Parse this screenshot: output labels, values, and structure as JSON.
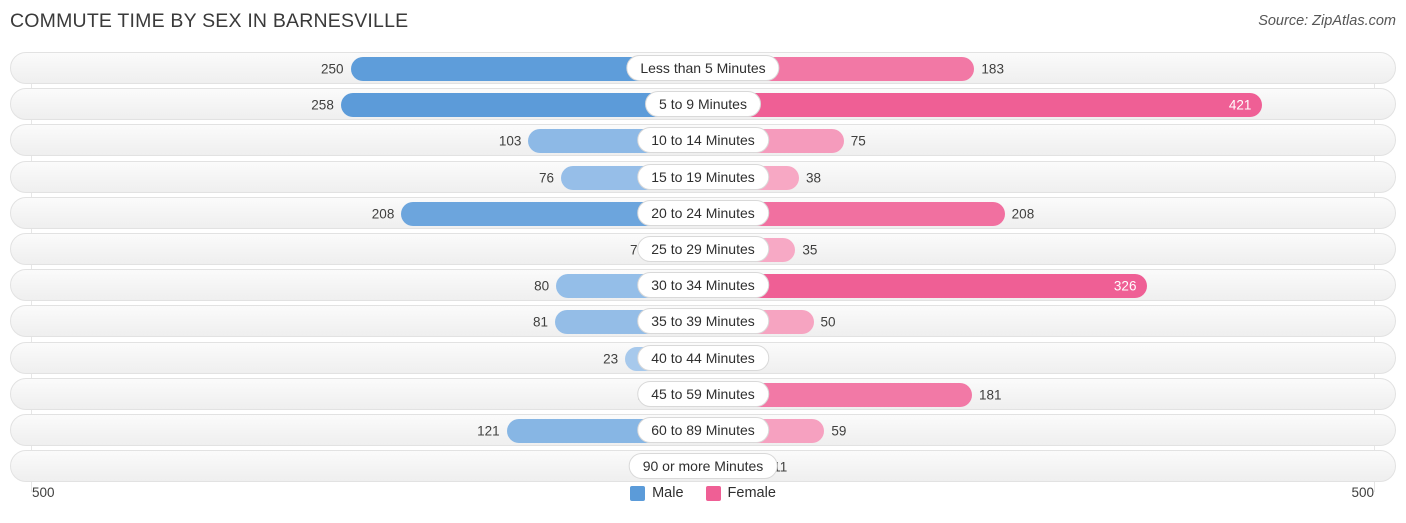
{
  "header": {
    "title": "COMMUTE TIME BY SEX IN BARNESVILLE",
    "source": "Source: ZipAtlas.com"
  },
  "axis": {
    "left_label": "500",
    "right_label": "500"
  },
  "legend": [
    {
      "label": "Male",
      "color": "#5b9bd9"
    },
    {
      "label": "Female",
      "color": "#ef5f95"
    }
  ],
  "chart_data": {
    "type": "bar",
    "subtype": "diverging-bidirectional",
    "title": "COMMUTE TIME BY SEX IN BARNESVILLE",
    "xlabel": "",
    "ylabel": "",
    "xlim": [
      500,
      500
    ],
    "grid": false,
    "legend_position": "bottom-center",
    "categories": [
      "Less than 5 Minutes",
      "5 to 9 Minutes",
      "10 to 14 Minutes",
      "15 to 19 Minutes",
      "20 to 24 Minutes",
      "25 to 29 Minutes",
      "30 to 34 Minutes",
      "35 to 39 Minutes",
      "40 to 44 Minutes",
      "45 to 59 Minutes",
      "60 to 89 Minutes",
      "90 or more Minutes"
    ],
    "series": [
      {
        "name": "Male",
        "side": "left",
        "values": [
          250,
          258,
          103,
          76,
          208,
          7,
          80,
          81,
          23,
          1,
          121,
          0
        ]
      },
      {
        "name": "Female",
        "side": "right",
        "values": [
          183,
          421,
          75,
          38,
          208,
          35,
          326,
          50,
          0,
          181,
          59,
          11
        ]
      }
    ]
  },
  "rows": [
    {
      "category": "Less than 5 Minutes",
      "male": "250",
      "female": "183"
    },
    {
      "category": "5 to 9 Minutes",
      "male": "258",
      "female": "421"
    },
    {
      "category": "10 to 14 Minutes",
      "male": "103",
      "female": "75"
    },
    {
      "category": "15 to 19 Minutes",
      "male": "76",
      "female": "38"
    },
    {
      "category": "20 to 24 Minutes",
      "male": "208",
      "female": "208"
    },
    {
      "category": "25 to 29 Minutes",
      "male": "7",
      "female": "35"
    },
    {
      "category": "30 to 34 Minutes",
      "male": "80",
      "female": "326"
    },
    {
      "category": "35 to 39 Minutes",
      "male": "81",
      "female": "50"
    },
    {
      "category": "40 to 44 Minutes",
      "male": "23",
      "female": "0"
    },
    {
      "category": "45 to 59 Minutes",
      "male": "1",
      "female": "181"
    },
    {
      "category": "60 to 89 Minutes",
      "male": "121",
      "female": "59"
    },
    {
      "category": "90 or more Minutes",
      "male": "0",
      "female": "11"
    }
  ]
}
